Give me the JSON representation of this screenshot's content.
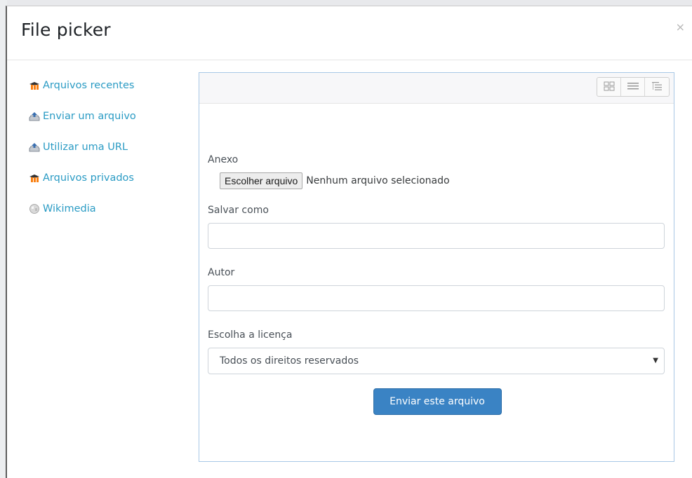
{
  "dialog": {
    "title": "File picker",
    "close_label": "×"
  },
  "sidebar": {
    "items": [
      {
        "label": "Arquivos recentes",
        "icon": "moodle-cap-icon"
      },
      {
        "label": "Enviar um arquivo",
        "icon": "upload-icon"
      },
      {
        "label": "Utilizar uma URL",
        "icon": "upload-icon"
      },
      {
        "label": "Arquivos privados",
        "icon": "moodle-cap-icon"
      },
      {
        "label": "Wikimedia",
        "icon": "wikimedia-globe-icon"
      }
    ]
  },
  "toolbar": {
    "views": [
      "icons-view-icon",
      "list-view-icon",
      "tree-view-icon"
    ]
  },
  "form": {
    "attachment_label": "Anexo",
    "choose_file_button": "Escolher arquivo",
    "no_file_text": "Nenhum arquivo selecionado",
    "save_as_label": "Salvar como",
    "save_as_value": "",
    "author_label": "Autor",
    "author_value": "",
    "license_label": "Escolha a licença",
    "license_selected": "Todos os direitos reservados",
    "submit_label": "Enviar este arquivo"
  },
  "colors": {
    "link": "#2a9bc4",
    "primary_button": "#3a83c4",
    "panel_border": "#a8c8e6"
  }
}
